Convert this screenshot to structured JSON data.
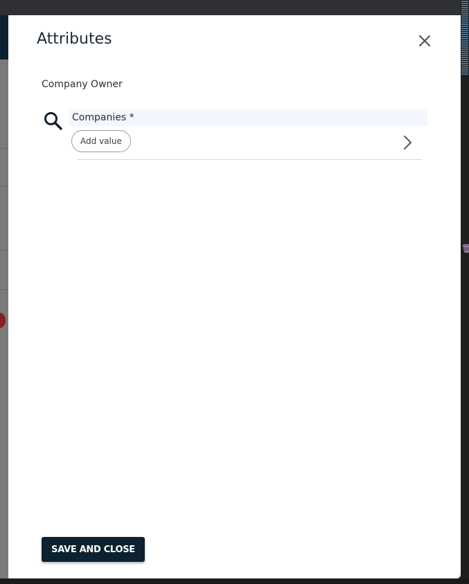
{
  "modal": {
    "title": "Attributes",
    "section_label": "Company Owner",
    "field": {
      "label": "Companies *",
      "add_value_label": "Add value"
    },
    "save_label": "SAVE AND CLOSE"
  },
  "colors": {
    "primary": "#0c2230",
    "field_bg": "#f1f7fc",
    "text": "#2a2f35"
  },
  "icons": {
    "close": "close-icon",
    "search": "search-icon",
    "chevron": "chevron-right-icon"
  }
}
